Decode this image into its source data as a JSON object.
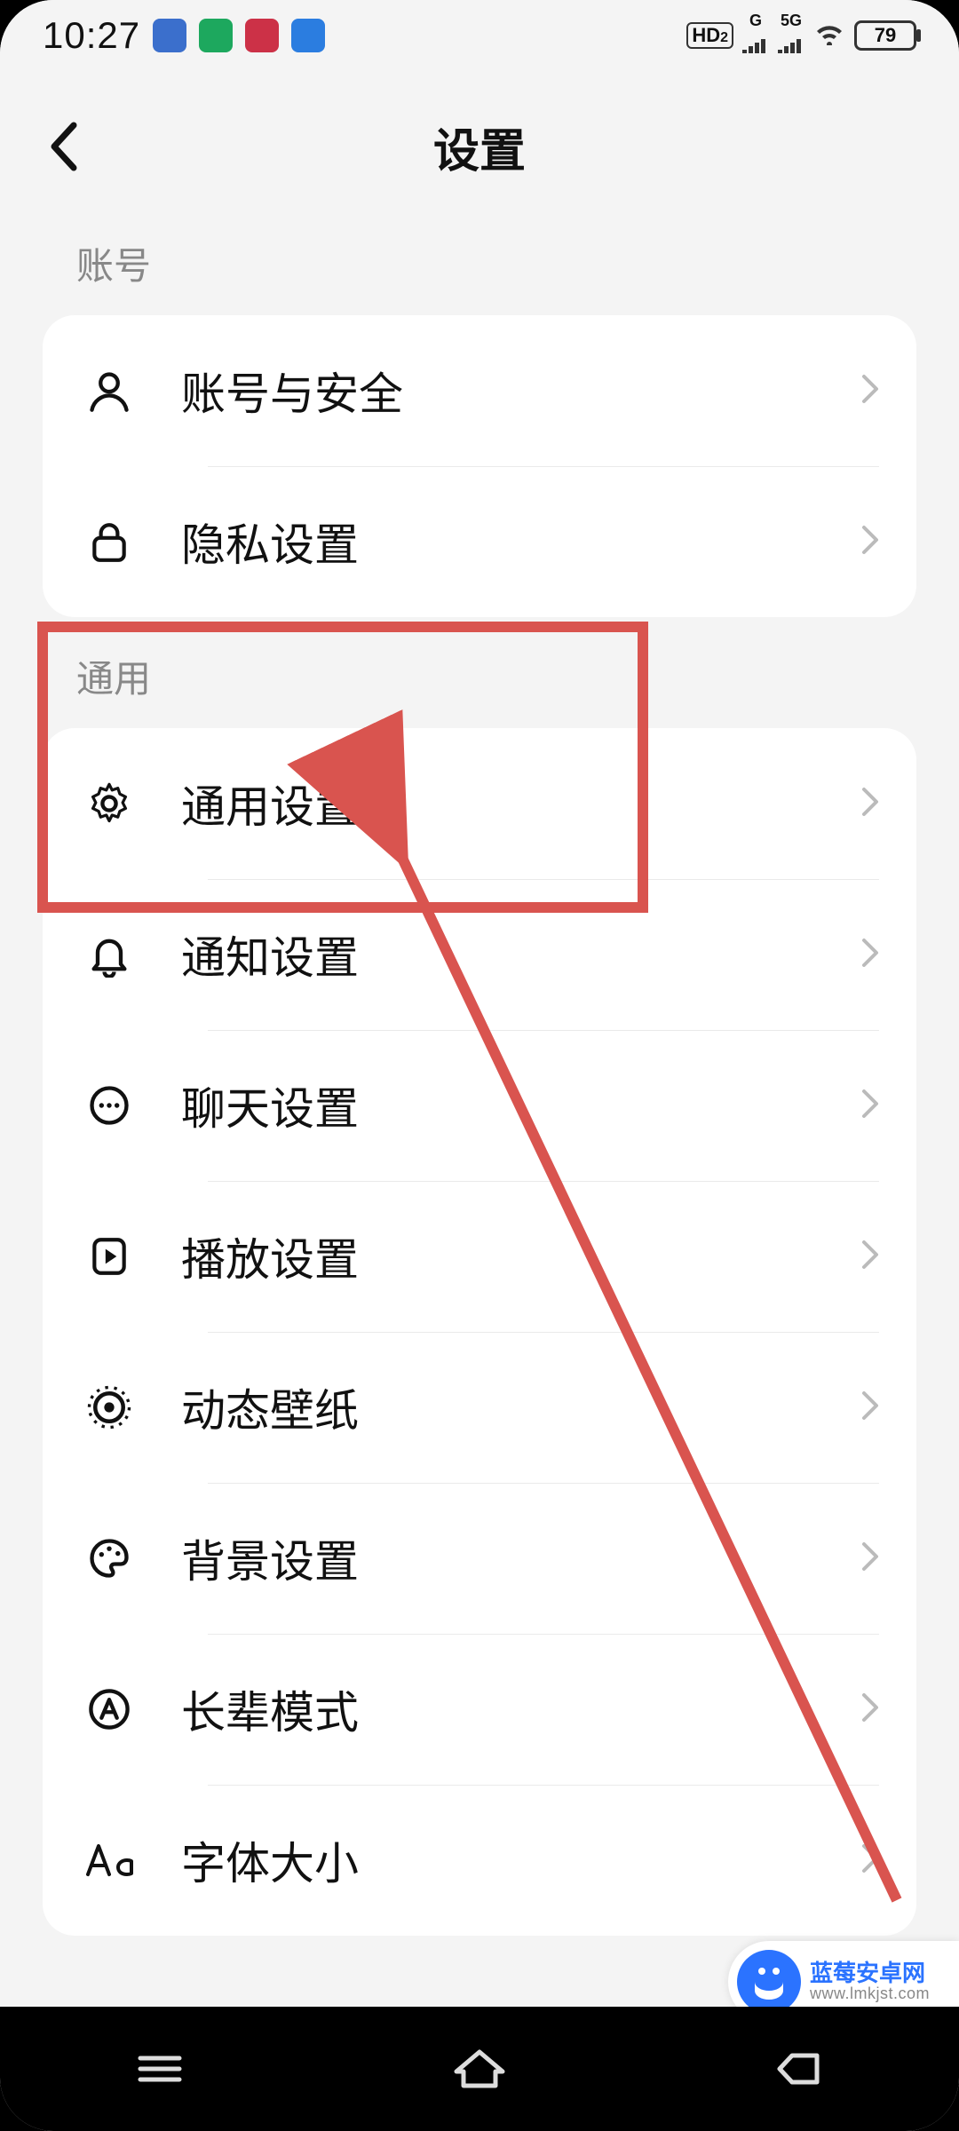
{
  "status_bar": {
    "time": "10:27",
    "hd_label": "HD",
    "hd_sub": "2",
    "net1": "G",
    "net2": "5G",
    "battery_pct": "79"
  },
  "header": {
    "title": "设置"
  },
  "sections": {
    "account_label": "账号",
    "account_rows": {
      "account_security": "账号与安全",
      "privacy": "隐私设置"
    },
    "general_label": "通用",
    "general_rows": {
      "general_settings": "通用设置",
      "notification": "通知设置",
      "chat": "聊天设置",
      "playback": "播放设置",
      "live_wallpaper": "动态壁纸",
      "background": "背景设置",
      "elder_mode": "长辈模式",
      "font_size": "字体大小"
    }
  },
  "watermark": {
    "line1": "蓝莓安卓网",
    "line2": "www.lmkjst.com"
  }
}
